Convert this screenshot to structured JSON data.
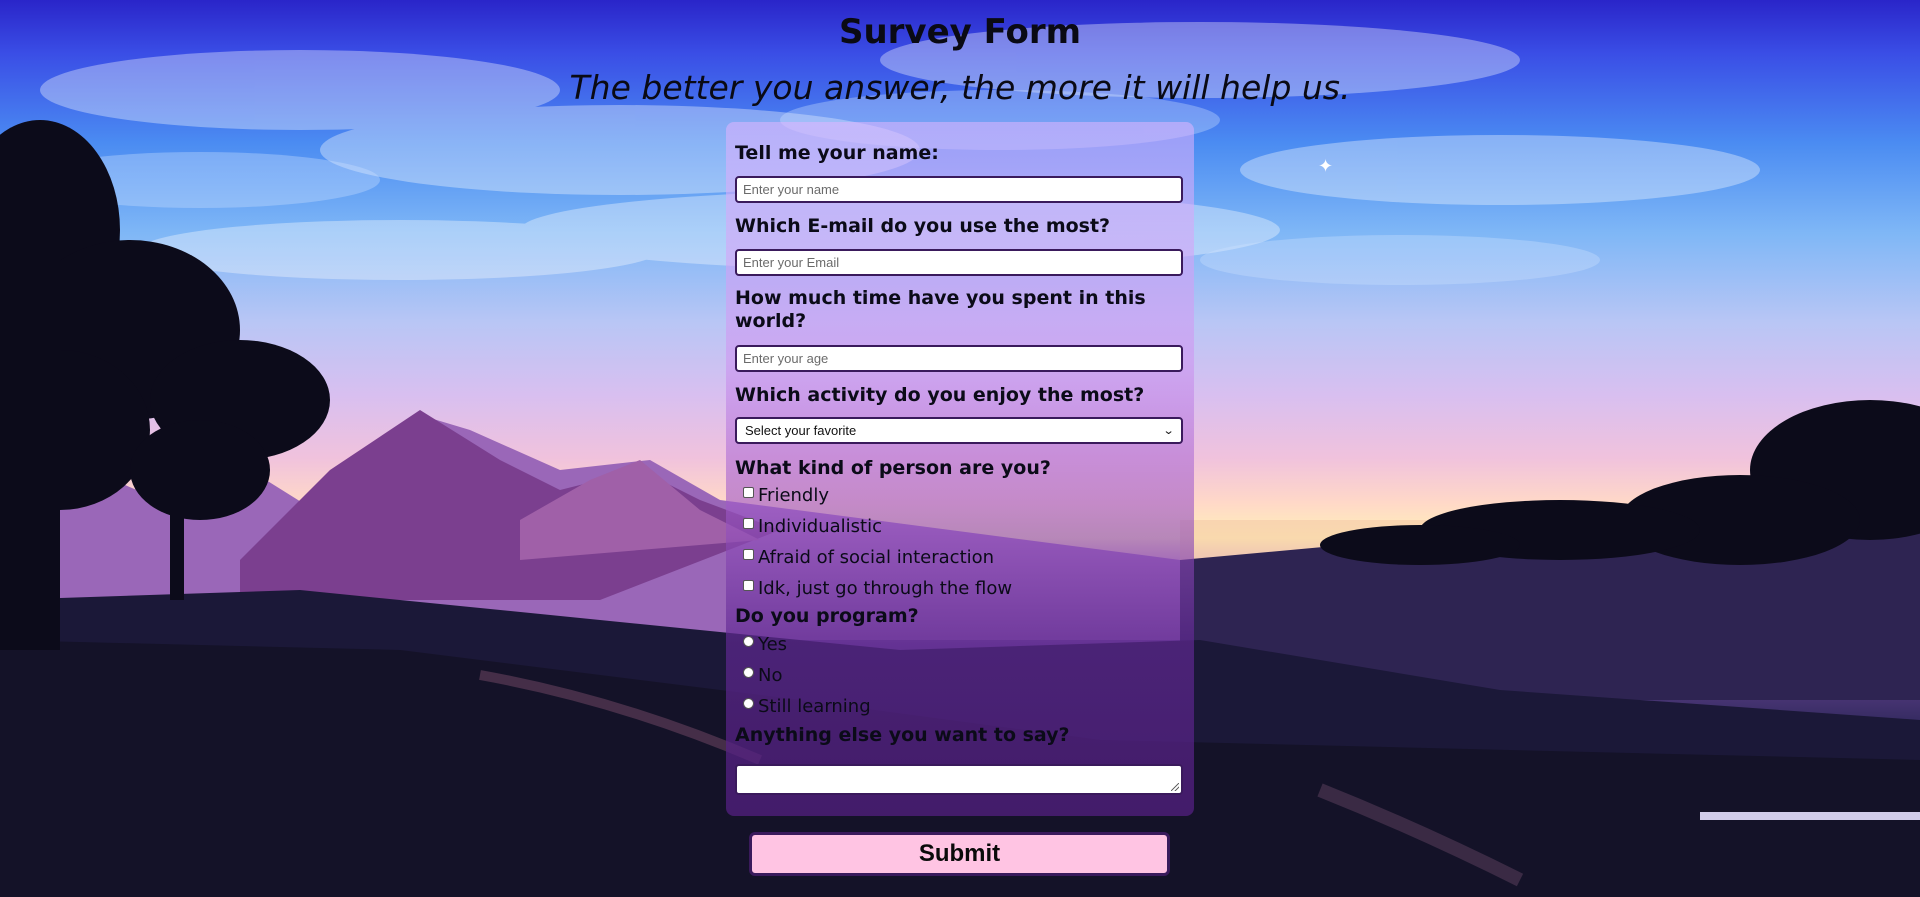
{
  "header": {
    "title": "Survey Form",
    "description": "The better you answer, the more it will help us."
  },
  "form": {
    "name": {
      "label": "Tell me your name:",
      "placeholder": "Enter your name"
    },
    "email": {
      "label": "Which E-mail do you use the most?",
      "placeholder": "Enter your Email"
    },
    "age": {
      "label": "How much time have you spent in this world?",
      "placeholder": "Enter your age"
    },
    "activity": {
      "label": "Which activity do you enjoy the most?",
      "selected": "Select your favorite"
    },
    "person": {
      "label": "What kind of person are you?",
      "options": [
        "Friendly",
        "Individualistic",
        "Afraid of social interaction",
        "Idk, just go through the flow"
      ]
    },
    "program": {
      "label": "Do you program?",
      "options": [
        "Yes",
        "No",
        "Still learning"
      ]
    },
    "comments": {
      "label": "Anything else you want to say?",
      "value": ""
    },
    "submit_label": "Submit"
  },
  "colors": {
    "panel": "#c896f0",
    "input_border": "#3a1a5c",
    "submit_bg": "#ffc4e3"
  }
}
